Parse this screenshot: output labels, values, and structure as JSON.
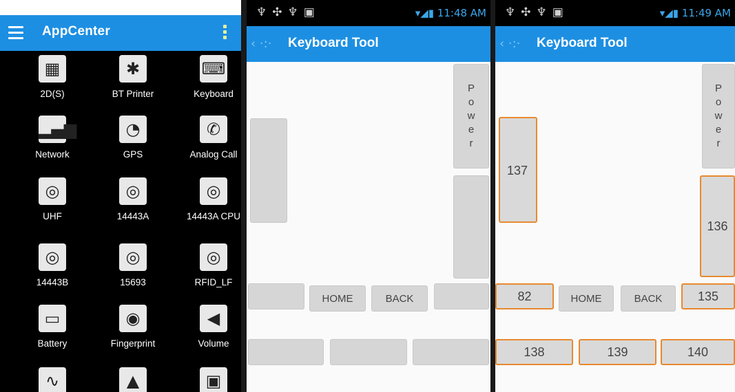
{
  "appcenter": {
    "title": "AppCenter",
    "apps": [
      {
        "label": "2D(S)",
        "icon": "qr-code-icon",
        "glyph": "▦"
      },
      {
        "label": "BT Printer",
        "icon": "bluetooth-icon",
        "glyph": "✱"
      },
      {
        "label": "Keyboard",
        "icon": "keyboard-icon",
        "glyph": "⌨"
      },
      {
        "label": "Network",
        "icon": "signal-bars-icon",
        "glyph": "▂▄▆"
      },
      {
        "label": "GPS",
        "icon": "satellite-dish-icon",
        "glyph": "◔"
      },
      {
        "label": "Analog Call",
        "icon": "phone-ringing-icon",
        "glyph": "✆"
      },
      {
        "label": "UHF",
        "icon": "rfid-icon",
        "glyph": "◎"
      },
      {
        "label": "14443A",
        "icon": "rfid-icon",
        "glyph": "◎"
      },
      {
        "label": "14443A CPU",
        "icon": "rfid-icon",
        "glyph": "◎"
      },
      {
        "label": "14443B",
        "icon": "rfid-icon",
        "glyph": "◎"
      },
      {
        "label": "15693",
        "icon": "rfid-icon",
        "glyph": "◎"
      },
      {
        "label": "RFID_LF",
        "icon": "rfid-icon",
        "glyph": "◎"
      },
      {
        "label": "Battery",
        "icon": "battery-icon",
        "glyph": "▭"
      },
      {
        "label": "Fingerprint",
        "icon": "fingerprint-icon",
        "glyph": "◉"
      },
      {
        "label": "Volume",
        "icon": "speaker-icon",
        "glyph": "◀"
      },
      {
        "label": "",
        "icon": "heartbeat-icon",
        "glyph": "∿"
      },
      {
        "label": "",
        "icon": "triangle-icon",
        "glyph": "▲"
      },
      {
        "label": "",
        "icon": "sim-card-icon",
        "glyph": "▣"
      }
    ]
  },
  "kb1": {
    "time": "11:48 AM",
    "title": "Keyboard Tool",
    "power": [
      "P",
      "o",
      "w",
      "e",
      "r"
    ],
    "home": "HOME",
    "back": "BACK"
  },
  "kb2": {
    "time": "11:49 AM",
    "title": "Keyboard Tool",
    "power": [
      "P",
      "o",
      "w",
      "e",
      "r"
    ],
    "home": "HOME",
    "back": "BACK",
    "k137": "137",
    "k136": "136",
    "k82": "82",
    "k135": "135",
    "k138": "138",
    "k139": "139",
    "k140": "140"
  },
  "colors": {
    "appbar": "#1d8fe2",
    "selected_border": "#e8892e",
    "key": "#d6d6d6"
  }
}
